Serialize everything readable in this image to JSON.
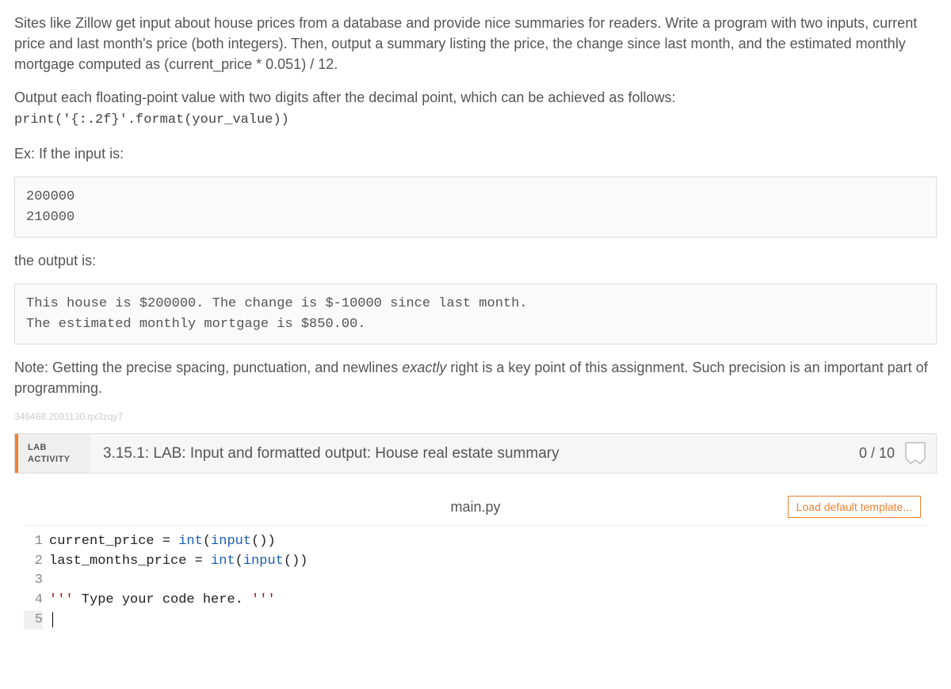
{
  "desc": {
    "p1": "Sites like Zillow get input about house prices from a database and provide nice summaries for readers. Write a program with two inputs, current price and last month's price (both integers). Then, output a summary listing the price, the change since last month, and the estimated monthly mortgage computed as (current_price * 0.051) / 12.",
    "p2_lead": "Output each floating-point value with two digits after the decimal point, which can be achieved as follows:",
    "p2_code": "print('{:.2f}'.format(your_value))",
    "p3": "Ex: If the input is:",
    "input_example": "200000\n210000",
    "p4": "the output is:",
    "output_example": "This house is $200000. The change is $-10000 since last month.\nThe estimated monthly mortgage is $850.00.",
    "p5_prefix": "Note: Getting the precise spacing, punctuation, and newlines ",
    "p5_italic": "exactly",
    "p5_suffix": " right is a key point of this assignment. Such precision is an important part of programming."
  },
  "watermark": "346468.2081130.qx3zqy7",
  "lab": {
    "label_line1": "LAB",
    "label_line2": "ACTIVITY",
    "title": "3.15.1: LAB: Input and formatted output: House real estate summary",
    "score": "0 / 10"
  },
  "editor": {
    "filename": "main.py",
    "load_template": "Load default template...",
    "lines": [
      "current_price = int(input())",
      "last_months_price = int(input())",
      "",
      "''' Type your code here. '''",
      ""
    ]
  }
}
